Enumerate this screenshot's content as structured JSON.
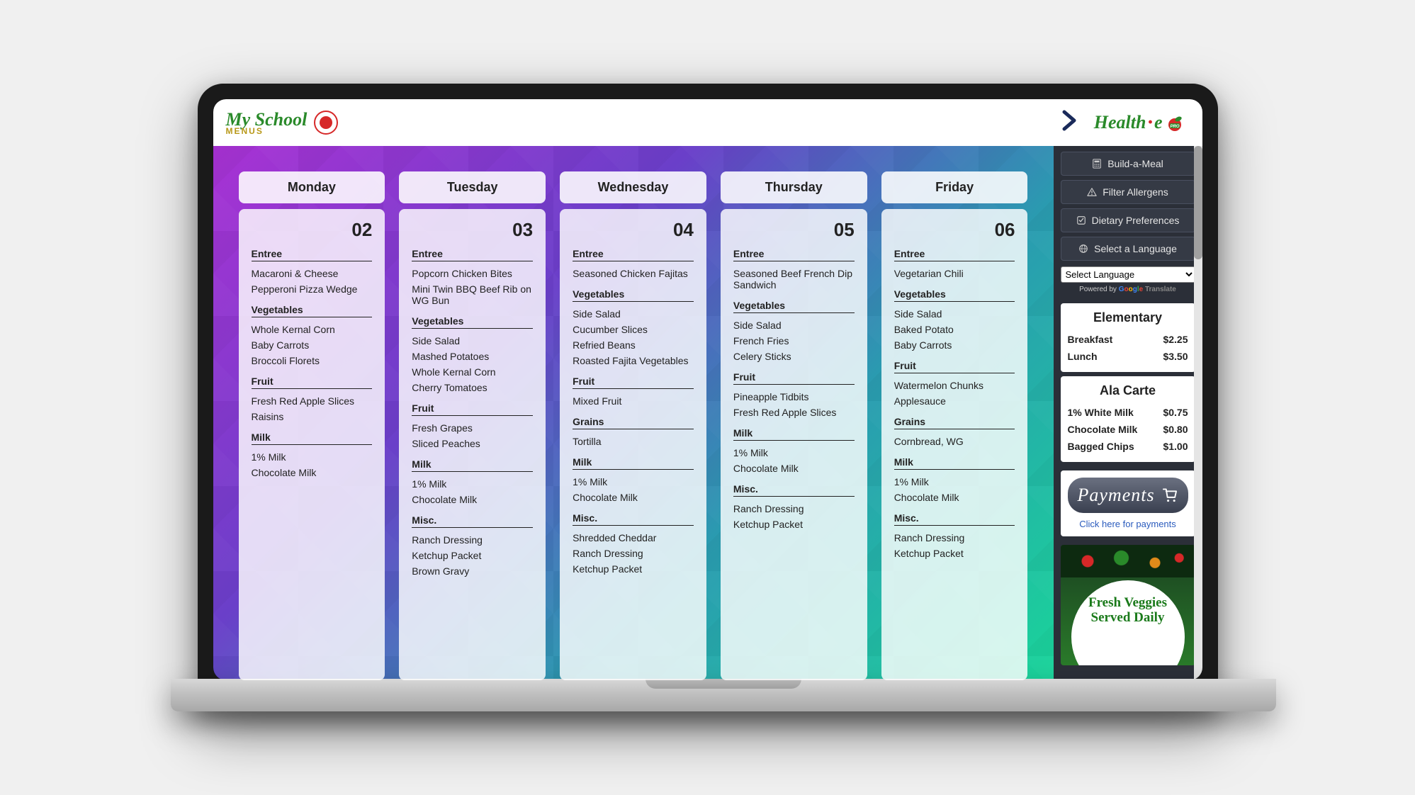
{
  "logo": {
    "line1": "My School",
    "line2": "MENUS"
  },
  "healthe": {
    "text": "Health",
    "e": "e"
  },
  "days": [
    {
      "name": "Monday",
      "date": "02",
      "sections": [
        {
          "title": "Entree",
          "items": [
            "Macaroni & Cheese",
            "Pepperoni Pizza Wedge"
          ]
        },
        {
          "title": "Vegetables",
          "items": [
            "Whole Kernal Corn",
            "Baby Carrots",
            "Broccoli Florets"
          ]
        },
        {
          "title": "Fruit",
          "items": [
            "Fresh Red Apple Slices",
            "Raisins"
          ]
        },
        {
          "title": "Milk",
          "items": [
            "1% Milk",
            "Chocolate Milk"
          ]
        }
      ]
    },
    {
      "name": "Tuesday",
      "date": "03",
      "sections": [
        {
          "title": "Entree",
          "items": [
            "Popcorn Chicken Bites",
            "Mini Twin BBQ Beef Rib on WG Bun"
          ]
        },
        {
          "title": "Vegetables",
          "items": [
            "Side Salad",
            "Mashed Potatoes",
            "Whole Kernal Corn",
            "Cherry Tomatoes"
          ]
        },
        {
          "title": "Fruit",
          "items": [
            "Fresh Grapes",
            "Sliced Peaches"
          ]
        },
        {
          "title": "Milk",
          "items": [
            "1% Milk",
            "Chocolate Milk"
          ]
        },
        {
          "title": "Misc.",
          "items": [
            "Ranch Dressing",
            "Ketchup Packet",
            "Brown Gravy"
          ]
        }
      ]
    },
    {
      "name": "Wednesday",
      "date": "04",
      "sections": [
        {
          "title": "Entree",
          "items": [
            "Seasoned Chicken Fajitas"
          ]
        },
        {
          "title": "Vegetables",
          "items": [
            "Side Salad",
            "Cucumber Slices",
            "Refried Beans",
            "Roasted Fajita Vegetables"
          ]
        },
        {
          "title": "Fruit",
          "items": [
            "Mixed Fruit"
          ]
        },
        {
          "title": "Grains",
          "items": [
            "Tortilla"
          ]
        },
        {
          "title": "Milk",
          "items": [
            "1% Milk",
            "Chocolate Milk"
          ]
        },
        {
          "title": "Misc.",
          "items": [
            "Shredded Cheddar",
            "Ranch Dressing",
            "Ketchup Packet"
          ]
        }
      ]
    },
    {
      "name": "Thursday",
      "date": "05",
      "sections": [
        {
          "title": "Entree",
          "items": [
            "Seasoned Beef French Dip Sandwich"
          ]
        },
        {
          "title": "Vegetables",
          "items": [
            "Side Salad",
            "French Fries",
            "Celery Sticks"
          ]
        },
        {
          "title": "Fruit",
          "items": [
            "Pineapple Tidbits",
            "Fresh Red Apple Slices"
          ]
        },
        {
          "title": "Milk",
          "items": [
            "1% Milk",
            "Chocolate Milk"
          ]
        },
        {
          "title": "Misc.",
          "items": [
            "Ranch Dressing",
            "Ketchup Packet"
          ]
        }
      ]
    },
    {
      "name": "Friday",
      "date": "06",
      "sections": [
        {
          "title": "Entree",
          "items": [
            "Vegetarian Chili"
          ]
        },
        {
          "title": "Vegetables",
          "items": [
            "Side Salad",
            "Baked Potato",
            "Baby Carrots"
          ]
        },
        {
          "title": "Fruit",
          "items": [
            "Watermelon Chunks",
            "Applesauce"
          ]
        },
        {
          "title": "Grains",
          "items": [
            "Cornbread, WG"
          ]
        },
        {
          "title": "Milk",
          "items": [
            "1% Milk",
            "Chocolate Milk"
          ]
        },
        {
          "title": "Misc.",
          "items": [
            "Ranch Dressing",
            "Ketchup Packet"
          ]
        }
      ]
    }
  ],
  "sidebarButtons": [
    {
      "icon": "calculator-icon",
      "label": "Build-a-Meal"
    },
    {
      "icon": "warning-icon",
      "label": "Filter Allergens"
    },
    {
      "icon": "check-icon",
      "label": "Dietary Preferences"
    },
    {
      "icon": "globe-icon",
      "label": "Select a Language"
    }
  ],
  "langSelect": {
    "placeholder": "Select Language"
  },
  "poweredBy": {
    "prefix": "Powered by ",
    "translate": "Translate"
  },
  "priceCards": [
    {
      "title": "Elementary",
      "rows": [
        {
          "label": "Breakfast",
          "price": "$2.25"
        },
        {
          "label": "Lunch",
          "price": "$3.50"
        }
      ]
    },
    {
      "title": "Ala Carte",
      "rows": [
        {
          "label": "1% White Milk",
          "price": "$0.75"
        },
        {
          "label": "Chocolate Milk",
          "price": "$0.80"
        },
        {
          "label": "Bagged Chips",
          "price": "$1.00"
        }
      ]
    }
  ],
  "payments": {
    "button": "Payments",
    "link": "Click here for payments"
  },
  "promo": {
    "line1": "Fresh Veggies",
    "line2": "Served Daily"
  }
}
